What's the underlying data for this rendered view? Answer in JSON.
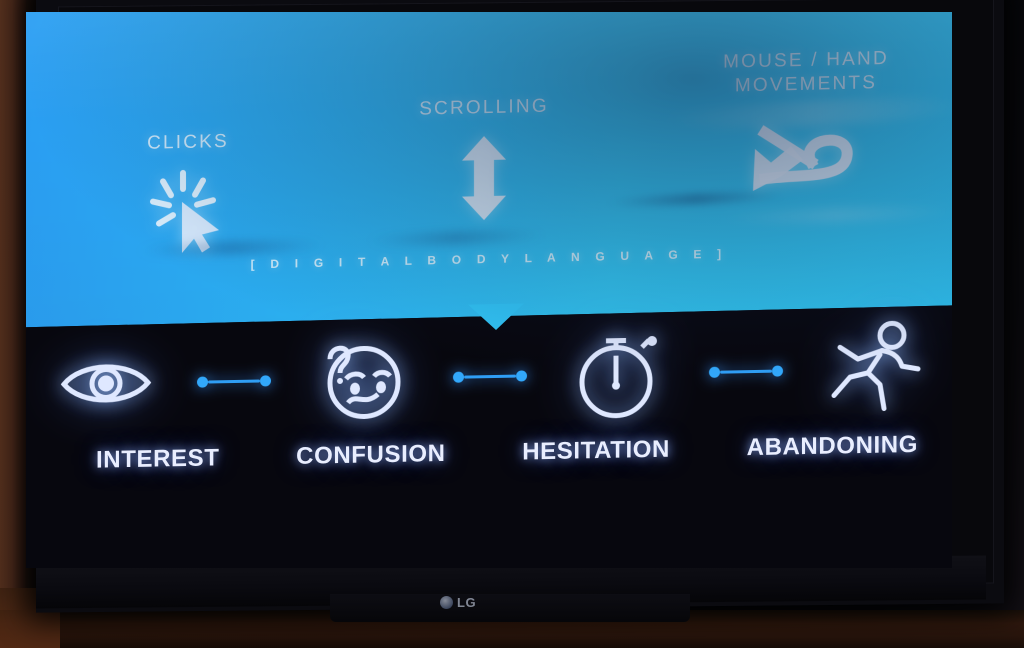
{
  "scene": {
    "device_brand": "LG",
    "colors": {
      "panel_blue_left": "#2a9cf2",
      "panel_blue_right": "#33cdfa",
      "stage_background": "#07070e",
      "connector_blue": "#32a8fb",
      "label_white": "#e9eeff"
    }
  },
  "slide": {
    "caption": "[  D I G I T A L   B O D Y   L A N G U A G E  ]",
    "signals": [
      {
        "label": "CLICKS",
        "icon": "click-cursor-icon"
      },
      {
        "label": "SCROLLING",
        "icon": "vertical-double-arrow-icon"
      },
      {
        "label": "MOUSE / HAND\nMOVEMENTS",
        "label_line1": "MOUSE / HAND",
        "label_line2": "MOVEMENTS",
        "icon": "looping-arrow-icon"
      }
    ],
    "stages": [
      {
        "label": "INTEREST",
        "icon": "eye-icon"
      },
      {
        "label": "CONFUSION",
        "icon": "confused-face-icon"
      },
      {
        "label": "HESITATION",
        "icon": "stopwatch-icon"
      },
      {
        "label": "ABANDONING",
        "icon": "running-person-icon"
      }
    ],
    "connector_icon": "dotted-line-connector-icon"
  }
}
